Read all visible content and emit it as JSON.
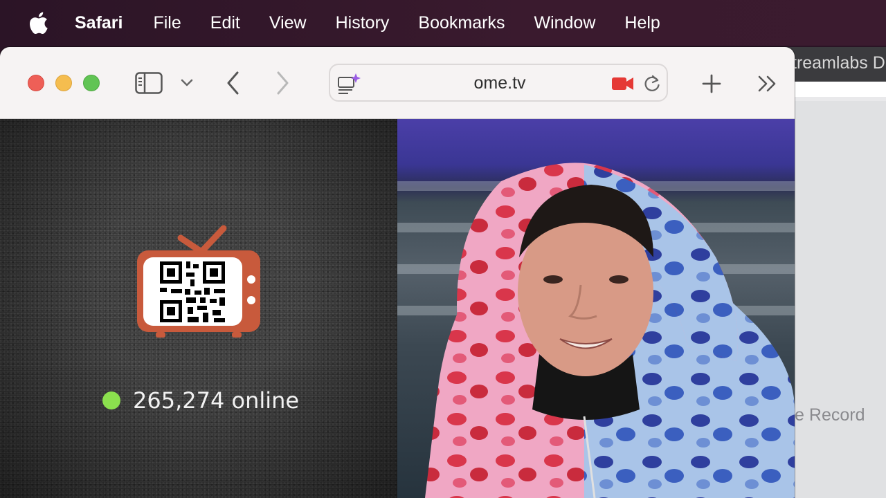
{
  "menubar": {
    "app_name": "Safari",
    "items": [
      "File",
      "Edit",
      "View",
      "History",
      "Bookmarks",
      "Window",
      "Help"
    ]
  },
  "toolbar": {
    "url": "ome.tv"
  },
  "background_window": {
    "tab_title": "treamlabs D",
    "text": "ive Record"
  },
  "page": {
    "online_count": "265,274 online"
  },
  "colors": {
    "status_online": "#8be04e",
    "tv_brand": "#c85a3c"
  }
}
